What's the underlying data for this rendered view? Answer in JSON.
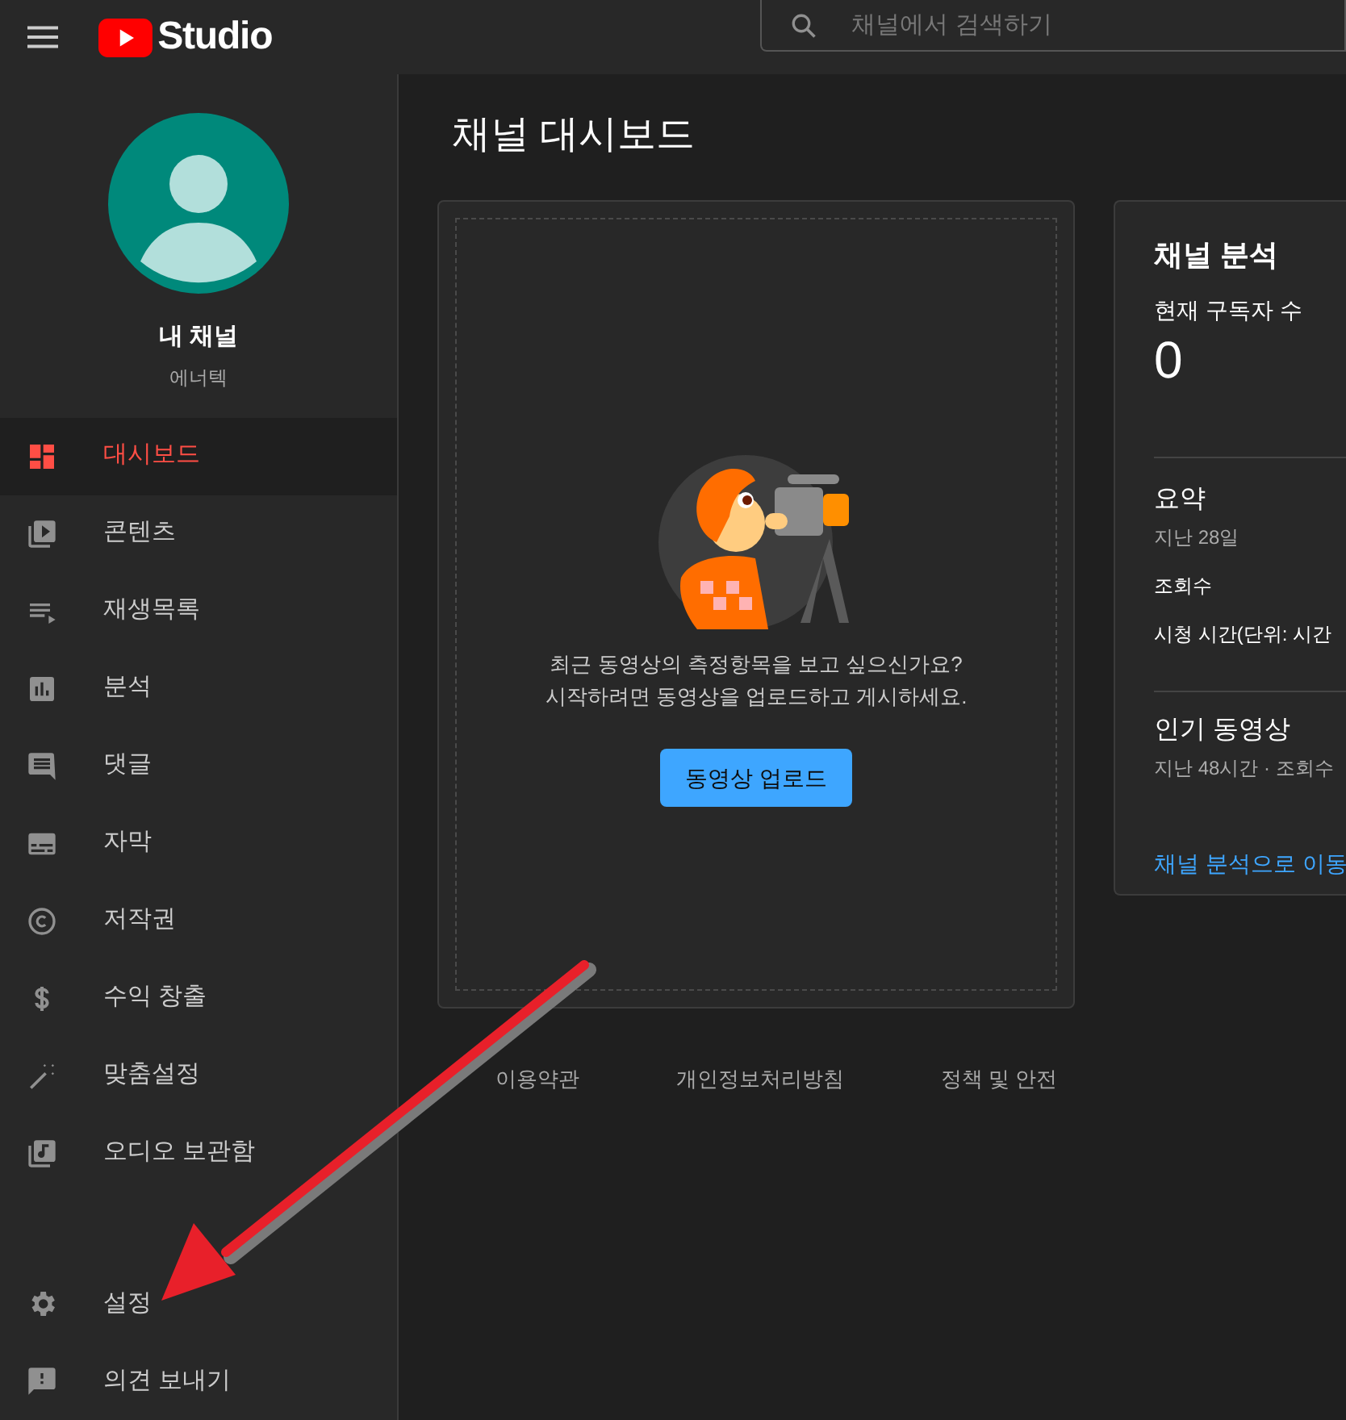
{
  "header": {
    "logo_text": "Studio",
    "search": {
      "placeholder": "채널에서 검색하기"
    }
  },
  "channel": {
    "name": "내 채널",
    "subtitle": "에너텍"
  },
  "sidebar": {
    "items": [
      {
        "label": "대시보드",
        "kind": "dashboard",
        "selected": true
      },
      {
        "label": "콘텐츠",
        "kind": "content",
        "selected": false
      },
      {
        "label": "재생목록",
        "kind": "playlist",
        "selected": false
      },
      {
        "label": "분석",
        "kind": "analytics",
        "selected": false
      },
      {
        "label": "댓글",
        "kind": "comments",
        "selected": false
      },
      {
        "label": "자막",
        "kind": "subtitles",
        "selected": false
      },
      {
        "label": "저작권",
        "kind": "copyright",
        "selected": false
      },
      {
        "label": "수익 창출",
        "kind": "money",
        "selected": false
      },
      {
        "label": "맞춤설정",
        "kind": "wand",
        "selected": false
      },
      {
        "label": "오디오 보관함",
        "kind": "audio",
        "selected": false
      }
    ],
    "bottom_items": [
      {
        "label": "설정",
        "kind": "settings",
        "selected": false
      },
      {
        "label": "의견 보내기",
        "kind": "feedback",
        "selected": false
      }
    ]
  },
  "page_title": "채널 대시보드",
  "upload_card": {
    "message_lines": [
      "최근 동영상의 측정항목을 보고 싶으신가요?",
      "시작하려면 동영상을 업로드하고 게시하세요."
    ],
    "button": "동영상 업로드"
  },
  "analytics_card": {
    "title": "채널 분석",
    "subscribers_label": "현재 구독자 수",
    "subscribers": "0",
    "summary_title": "요약",
    "summary_period": "지난 28일",
    "metrics": [
      "조회수",
      "시청 시간(단위: 시간"
    ],
    "popular_title": "인기 동영상",
    "popular_period": "지난 48시간 · 조회수",
    "link": "채널 분석으로 이동"
  },
  "footer_links": [
    "이용약관",
    "개인정보처리방침",
    "정책 및 안전"
  ],
  "annotation": {
    "kind": "arrow"
  }
}
